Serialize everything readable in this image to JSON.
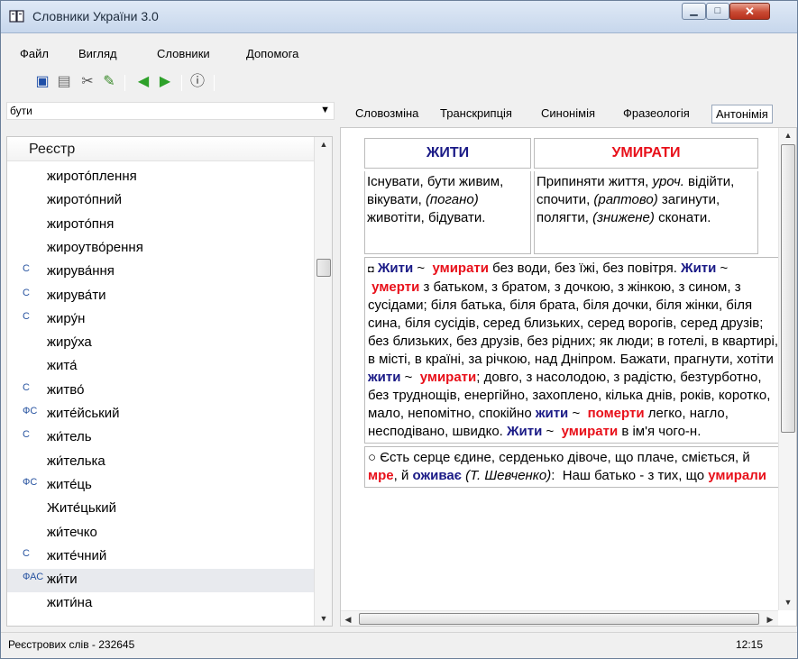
{
  "window": {
    "title": "Словники України 3.0"
  },
  "menu": [
    "Файл",
    "Вигляд",
    "Словники",
    "Допомога"
  ],
  "search": {
    "value": "бути"
  },
  "tabs": [
    "Словозміна",
    "Транскрипція",
    "Синонімія",
    "Фразеологія",
    "Антонімія"
  ],
  "active_tab": "Антонімія",
  "register": {
    "header": "Реєстр",
    "items": [
      {
        "mark": "",
        "word": "жирото́плення"
      },
      {
        "mark": "",
        "word": "жирото́пний"
      },
      {
        "mark": "",
        "word": "жирото́пня"
      },
      {
        "mark": "",
        "word": "жироутво́рення"
      },
      {
        "mark": "С",
        "word": "жирува́ння"
      },
      {
        "mark": "С",
        "word": "жирува́ти"
      },
      {
        "mark": "С",
        "word": "жиру́н"
      },
      {
        "mark": "",
        "word": "жиру́ха"
      },
      {
        "mark": "",
        "word": "жита́"
      },
      {
        "mark": "С",
        "word": "житво́"
      },
      {
        "mark": "ФС",
        "word": "жите́йський"
      },
      {
        "mark": "С",
        "word": "жи́тель"
      },
      {
        "mark": "",
        "word": "жи́телька"
      },
      {
        "mark": "ФС",
        "word": "жите́ць"
      },
      {
        "mark": "",
        "word": "Жите́цький"
      },
      {
        "mark": "",
        "word": "жи́течко"
      },
      {
        "mark": "С",
        "word": "жите́чний"
      },
      {
        "mark": "ФАС",
        "word": "жи́ти"
      },
      {
        "mark": "",
        "word": "жити́на"
      }
    ]
  },
  "antonyms": {
    "left": {
      "head": "ЖИТИ",
      "def": "Існувати, бути живим, вікувати, (погано) животіти, бідувати."
    },
    "right": {
      "head": "УМИРАТИ",
      "def": "Припиняти життя, уроч. відійти, спочити, (раптово) загинути, полягти, (знижене) сконати."
    }
  },
  "para1": "Жити ~ умирати без води, без їжі, без повітря. Жити ~ умерти з батьком, з братом, з дочкою, з жінкою, з сином, з сусідами; біля батька, біля брата, біля дочки, біля жінки, біля сина, біля сусідів, серед близьких, серед ворогів, серед друзів; без близьких, без друзів, без рідних; як люди; в готелі, в квартирі, в місті, в країні, за річкою, над Дніпром. Бажати, прагнути, хотіти жити ~ умирати; довго, з насолодою, з радістю, безтурботно, без труднощів, енергійно, захоплено, кілька днів, років, коротко, мало, непомітно, спокійно жити ~ померти легко, нагло, несподівано, швидко. Жити ~ умирати в ім'я чого-н.",
  "para2": "Єсть серце єдине, серденько дівоче, що плаче, сміється, й мре, й оживає (Т. Шевченко): Наш батько - з тих, що умирали",
  "status": {
    "left": "Реєстрових слів - 232645",
    "right": "12:15"
  },
  "colors": {
    "accent_blue": "#1a1a86",
    "accent_red": "#e8101a"
  }
}
